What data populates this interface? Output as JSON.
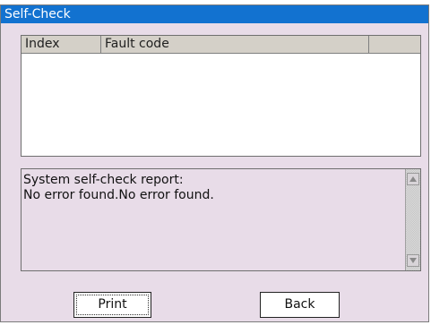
{
  "window": {
    "title": "Self-Check"
  },
  "fault_list": {
    "columns": [
      "Index",
      "Fault code",
      ""
    ],
    "rows": []
  },
  "report": {
    "lines": [
      "System self-check report:",
      "No error found.No error found."
    ]
  },
  "buttons": {
    "print_label": "Print",
    "back_label": "Back"
  },
  "colors": {
    "title_bar": "#1272d0",
    "window_background": "#e8dce8"
  },
  "icons": {
    "scroll_up": "triangle-up-icon",
    "scroll_down": "triangle-down-icon"
  }
}
